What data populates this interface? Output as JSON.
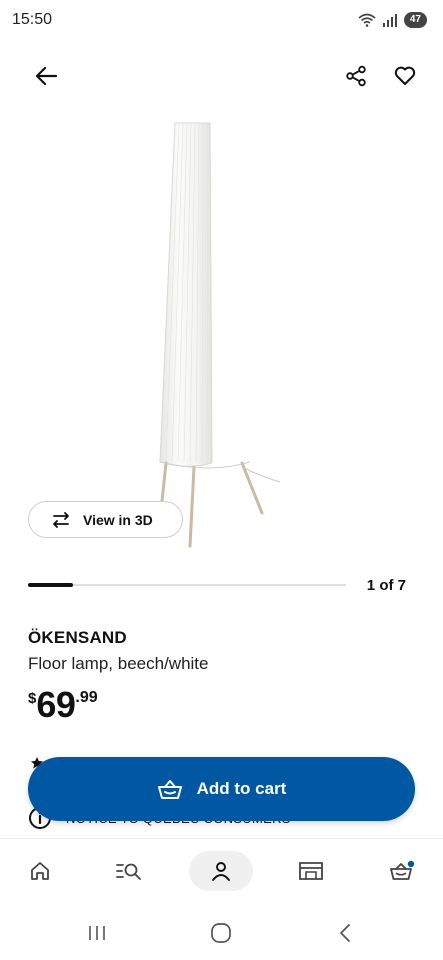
{
  "status_bar": {
    "time": "15:50",
    "battery": "47"
  },
  "product": {
    "name": "ÖKENSAND",
    "description": "Floor lamp, beech/white",
    "price": {
      "currency": "$",
      "main": "69",
      "cents": ".99"
    }
  },
  "gallery": {
    "view_3d_label": "View in 3D",
    "current": "1",
    "of": "of",
    "total": "7",
    "progress": 0.14
  },
  "cart": {
    "add_label": "Add to cart"
  },
  "notice": {
    "text": "NOTICE TO QUEBEC CONSUMERS"
  },
  "colors": {
    "accent": "#0058a3",
    "cart_badge": "#0058a3"
  },
  "nav": {
    "items": [
      {
        "icon": "home-icon"
      },
      {
        "icon": "search-list-icon"
      },
      {
        "icon": "profile-icon",
        "active": true
      },
      {
        "icon": "store-icon"
      },
      {
        "icon": "cart-icon"
      }
    ]
  }
}
